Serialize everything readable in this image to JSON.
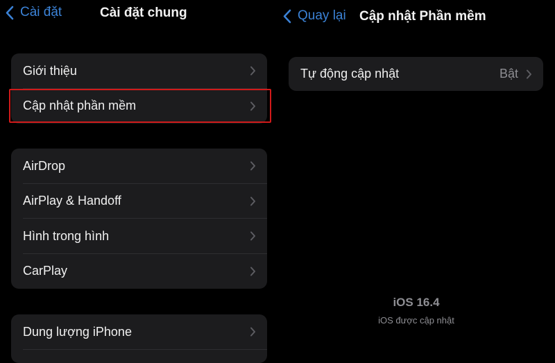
{
  "left_screen": {
    "nav": {
      "back_label": "Cài đặt",
      "title": "Cài đặt chung"
    },
    "groups": [
      {
        "items": [
          {
            "label": "Giới thiệu"
          },
          {
            "label": "Cập nhật phần mềm",
            "highlighted": true
          }
        ]
      },
      {
        "items": [
          {
            "label": "AirDrop"
          },
          {
            "label": "AirPlay & Handoff"
          },
          {
            "label": "Hình trong hình"
          },
          {
            "label": "CarPlay"
          }
        ]
      },
      {
        "items": [
          {
            "label": "Dung lượng iPhone"
          }
        ]
      }
    ]
  },
  "right_screen": {
    "nav": {
      "back_label": "Quay lại",
      "title": "Cập nhật Phần mềm"
    },
    "settings": [
      {
        "label": "Tự động cập nhật",
        "value": "Bật"
      }
    ],
    "version": {
      "title": "iOS 16.4",
      "subtitle": "iOS được cập nhật"
    }
  },
  "colors": {
    "accent": "#3b82d6",
    "background": "#000000",
    "cell": "#1c1c1e",
    "highlight_border": "#d11a1a",
    "secondary_text": "#8e8e93"
  },
  "icons": {
    "back": "chevron-left-icon",
    "disclosure": "chevron-right-icon"
  }
}
